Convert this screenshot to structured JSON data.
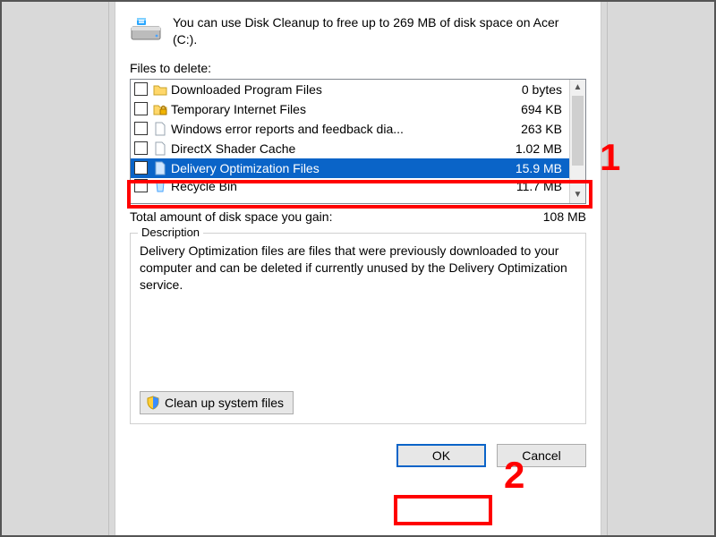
{
  "intro": "You can use Disk Cleanup to free up to 269 MB of disk space on Acer (C:).",
  "files_label": "Files to delete:",
  "rows": [
    {
      "name": "Downloaded Program Files",
      "size": "0 bytes",
      "checked": false,
      "icon": "folder"
    },
    {
      "name": "Temporary Internet Files",
      "size": "694 KB",
      "checked": false,
      "icon": "lockfolder"
    },
    {
      "name": "Windows error reports and feedback dia...",
      "size": "263 KB",
      "checked": false,
      "icon": "file"
    },
    {
      "name": "DirectX Shader Cache",
      "size": "1.02 MB",
      "checked": false,
      "icon": "file"
    },
    {
      "name": "Delivery Optimization Files",
      "size": "15.9 MB",
      "checked": true,
      "icon": "file",
      "selected": true
    },
    {
      "name": "Recycle Bin",
      "size": "11.7 MB",
      "checked": false,
      "icon": "recycle"
    }
  ],
  "total_label": "Total amount of disk space you gain:",
  "total_value": "108 MB",
  "description_group": "Description",
  "description_text": "Delivery Optimization files are files that were previously downloaded to your computer and can be deleted if currently unused by the Delivery Optimization service.",
  "cleanup_button": "Clean up system files",
  "ok": "OK",
  "cancel": "Cancel",
  "annotations": {
    "num1": "1",
    "num2": "2"
  }
}
